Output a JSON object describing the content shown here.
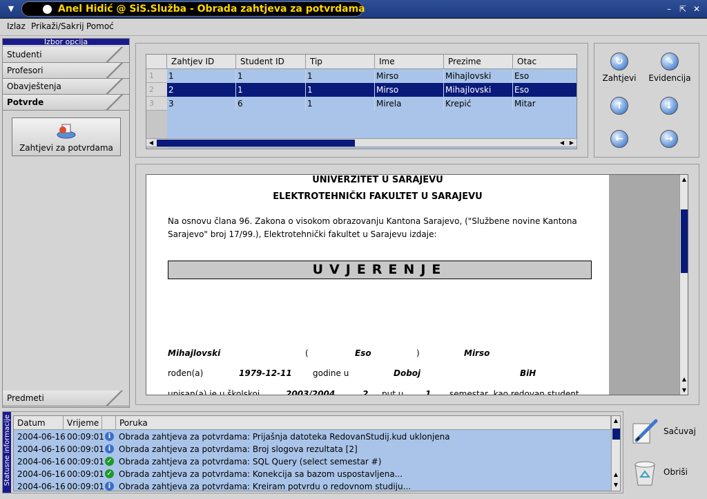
{
  "window": {
    "title": "Anel Hidić @ SiS.Služba - Obrada zahtjeva za potvrdama"
  },
  "menu": [
    "Izlaz",
    "Prikaži/Sakrij",
    "Pomoć"
  ],
  "sidebar": {
    "header": "Izbor opcija",
    "tabs": [
      "Studenti",
      "Profesori",
      "Obavještenja",
      "Potvrde"
    ],
    "active_tab": "Potvrde",
    "action_button": "Zahtjevi za potvrdama",
    "bottom_tab": "Predmeti"
  },
  "grid": {
    "columns": [
      "Zahtjev ID",
      "Student ID",
      "Tip",
      "Ime",
      "Prezime",
      "Otac"
    ],
    "rows": [
      {
        "num": "1",
        "cells": [
          "1",
          "1",
          "1",
          "Mirso",
          "Mihajlovski",
          "Eso"
        ]
      },
      {
        "num": "2",
        "cells": [
          "2",
          "1",
          "1",
          "Mirso",
          "Mihajlovski",
          "Eso"
        ],
        "selected": true
      },
      {
        "num": "3",
        "cells": [
          "3",
          "6",
          "1",
          "Mirela",
          "Krepić",
          "Mitar"
        ]
      }
    ]
  },
  "nav": {
    "zahtjevi": "Zahtjevi",
    "evidencija": "Evidencija"
  },
  "document": {
    "university": "UNIVERZITET U SARAJEVU",
    "faculty": "ELEKTROTEHNIČKI FAKULTET U SARAJEVU",
    "intro": "Na osnovu člana 96. Zakona o visokom obrazovanju Kantona Sarajevo, (\"Službene novine Kantona Sarajevo\" broj 17/99.), Elektrotehnički fakultet u Sarajevu izdaje:",
    "heading": "UVJERENJE",
    "surname": "Mihajlovski",
    "paren_open": "(",
    "father": "Eso",
    "paren_close": ")",
    "name": "Mirso",
    "born_label": "rođen(a)",
    "birth_date": "1979-12-11",
    "year_label": "godine u",
    "birth_place": "Doboj",
    "country": "BiH",
    "enrolled_label": "upisan(a) je u školskoj",
    "school_year": "2003/2004",
    "times": "2",
    "times_label": "put u",
    "semester": "1",
    "semester_label": "semestar, kao redovan student"
  },
  "status": {
    "vertical_label": "Statusne informacije",
    "columns": [
      "Datum",
      "Vrijeme",
      "",
      "Poruka"
    ],
    "rows": [
      {
        "date": "2004-06-16",
        "time": "00:09:01",
        "type": "info",
        "message": "Obrada zahtjeva za potvrdama: Prijašnja datoteka RedovanStudij.kud uklonjena"
      },
      {
        "date": "2004-06-16",
        "time": "00:09:01",
        "type": "info",
        "message": "Obrada zahtjeva za potvrdama: Broj slogova rezultata [2]"
      },
      {
        "date": "2004-06-16",
        "time": "00:09:01",
        "type": "ok",
        "message": "Obrada zahtjeva za potvrdama: SQL Query (select semestar #)"
      },
      {
        "date": "2004-06-16",
        "time": "00:09:01",
        "type": "ok",
        "message": "Obrada zahtjeva za potvrdama: Konekcija sa bazom uspostavljena..."
      },
      {
        "date": "2004-06-16",
        "time": "00:09:01",
        "type": "info",
        "message": "Obrada zahtjeva za potvrdama: Kreiram potvrdu o redovnom studiju..."
      }
    ]
  },
  "actions": {
    "save": "Sačuvaj",
    "delete": "Obriši"
  }
}
